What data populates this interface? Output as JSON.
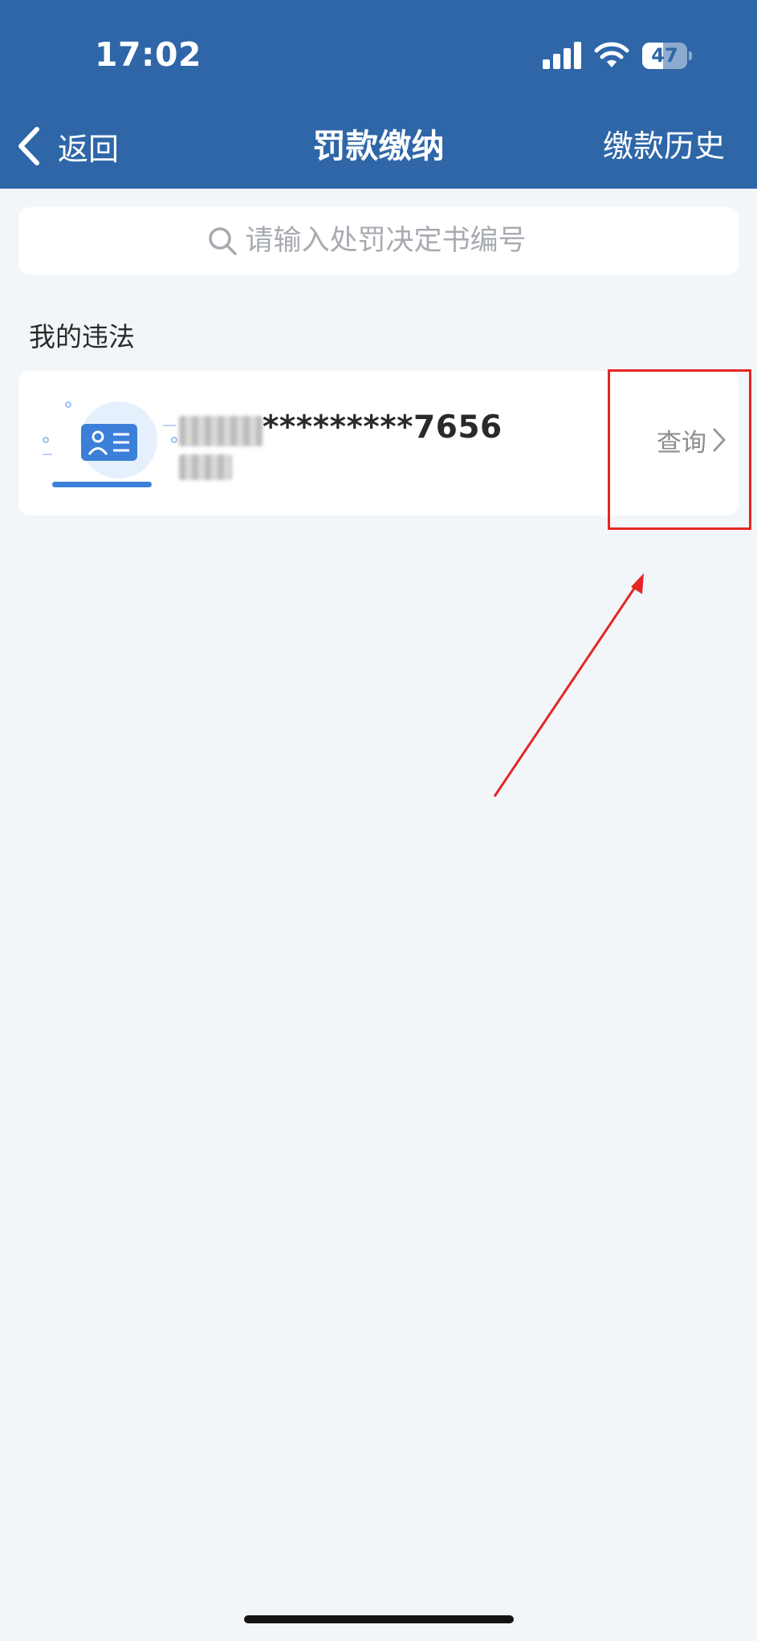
{
  "status_bar": {
    "time": "17:02",
    "battery": "47",
    "battery_level": 0.47,
    "icons": [
      "signal-icon",
      "wifi-icon",
      "battery-icon"
    ]
  },
  "nav": {
    "back_label": "返回",
    "title": "罚款缴纳",
    "history_label": "缴款历史",
    "back_icon": "chevron-left-icon"
  },
  "search": {
    "placeholder": "请输入处罚决定书编号",
    "value": "",
    "icon": "search-icon"
  },
  "section": {
    "title": "我的违法"
  },
  "vehicle_card": {
    "plate_suffix": "*********7656",
    "query_label": "查询",
    "illustration_icon": "id-card-icon",
    "chevron_icon": "chevron-right-icon"
  },
  "colors": {
    "header_bg": "#2e66a8",
    "page_bg": "#f2f6f9",
    "card_bg": "#ffffff",
    "highlight": "#e62525",
    "accent_blue": "#3b7fd9"
  }
}
